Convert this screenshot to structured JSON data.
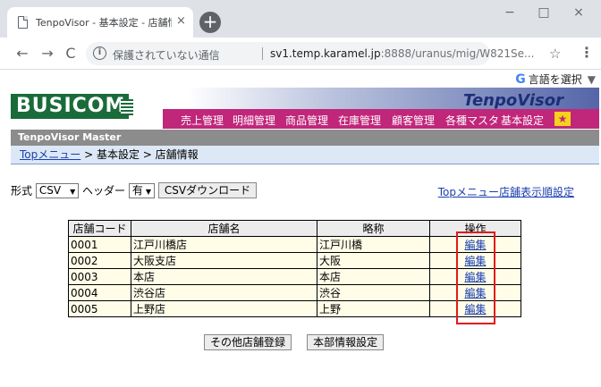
{
  "browser": {
    "tab_title": "TenpoVisor - 基本設定 - 店舗情報",
    "tab_close": "×",
    "new_tab": "+",
    "minimize": "−",
    "maximize": "□",
    "close": "×",
    "back": "←",
    "forward": "→",
    "reload": "C",
    "info": "i",
    "insecure_text": "保護されていない通信",
    "url_main": "sv1.temp.karamel.jp",
    "url_rest": ":8888/uranus/mig/W821Se...",
    "star": "☆",
    "menu": "⋮"
  },
  "translate": {
    "g": "G",
    "label": "言語を選択",
    "arrow": "▼"
  },
  "header": {
    "logo": "BUSICOM",
    "tenpovisor_logo": "TenpoVisor",
    "menu": [
      "売上管理",
      "明細管理",
      "商品管理",
      "在庫管理",
      "顧客管理",
      "各種マスタ",
      "基本設定"
    ],
    "favorite": "★",
    "system_title": "TenpoVisor Master"
  },
  "breadcrumb": {
    "top": "Topメニュー",
    "path": " > 基本設定 > 店舗情報"
  },
  "export": {
    "format_label": "形式",
    "format_value": "CSV",
    "header_label": "ヘッダー",
    "header_value": "有",
    "download_button": "CSVダウンロード",
    "caret": "▼"
  },
  "order_link": "Topメニュー店舗表示順設定",
  "table": {
    "columns": [
      "店舗コード",
      "店舗名",
      "略称",
      "操作"
    ],
    "rows": [
      {
        "code": "0001",
        "name": "江戸川橋店",
        "short": "江戸川橋",
        "action": "編集"
      },
      {
        "code": "0002",
        "name": "大阪支店",
        "short": "大阪",
        "action": "編集"
      },
      {
        "code": "0003",
        "name": "本店",
        "short": "本店",
        "action": "編集"
      },
      {
        "code": "0004",
        "name": "渋谷店",
        "short": "渋谷",
        "action": "編集"
      },
      {
        "code": "0005",
        "name": "上野店",
        "short": "上野",
        "action": "編集"
      }
    ]
  },
  "buttons": {
    "other_store": "その他店舗登録",
    "hq_settings": "本部情報設定"
  }
}
